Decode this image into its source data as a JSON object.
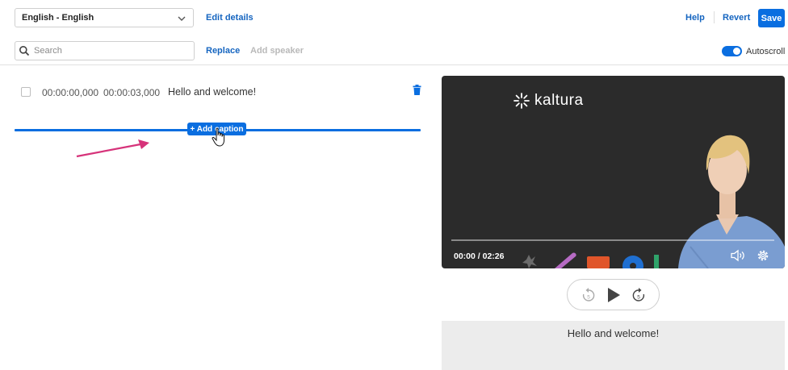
{
  "toolbar": {
    "language": "English - English",
    "edit_details": "Edit details",
    "help": "Help",
    "revert": "Revert",
    "save": "Save",
    "search_placeholder": "Search",
    "replace": "Replace",
    "add_speaker": "Add speaker",
    "autoscroll_label": "Autoscroll",
    "autoscroll_on": true
  },
  "captions": [
    {
      "start": "00:00:00,000",
      "end": "00:00:03,000",
      "text": "Hello and welcome!"
    }
  ],
  "add_caption_label": "+ Add caption",
  "player": {
    "brand": "kaltura",
    "timecode": "00:00 / 02:26",
    "progress": 0
  },
  "preview": {
    "caption": "Hello and welcome!"
  },
  "colors": {
    "accent": "#0a6ee0",
    "annotation_arrow": "#d6337a"
  }
}
